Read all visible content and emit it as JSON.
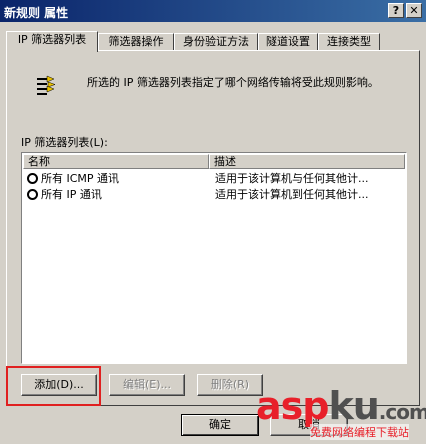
{
  "window": {
    "title": "新规则 属性",
    "help_glyph": "?",
    "close_glyph": "✕"
  },
  "tabs": [
    {
      "label": "IP 筛选器列表",
      "active": true
    },
    {
      "label": "筛选器操作",
      "active": false
    },
    {
      "label": "身份验证方法",
      "active": false
    },
    {
      "label": "隧道设置",
      "active": false
    },
    {
      "label": "连接类型",
      "active": false
    }
  ],
  "panel": {
    "icon": "ip-filter-list-icon",
    "description": "所选的 IP 筛选器列表指定了哪个网络传输将受此规则影响。",
    "list_label": "IP 筛选器列表(L):",
    "columns": {
      "name": "名称",
      "description": "描述"
    },
    "rows": [
      {
        "name": "所有 ICMP 通讯",
        "description": "适用于该计算机与任何其他计..."
      },
      {
        "name": "所有 IP 通讯",
        "description": "适用于该计算机到任何其他计..."
      }
    ],
    "buttons": {
      "add": "添加(D)...",
      "edit": "编辑(E)...",
      "delete": "删除(R)"
    }
  },
  "footer": {
    "ok": "确定",
    "cancel": "取消"
  },
  "watermark": {
    "red_part": "asp",
    "gray_part": "ku",
    "suffix": ".com",
    "tagline": "免费网络编程下载站"
  },
  "colors": {
    "title_start": "#0a246a",
    "title_end": "#3a6ea5",
    "highlight": "#e02020",
    "watermark_red": "#e8202a"
  }
}
